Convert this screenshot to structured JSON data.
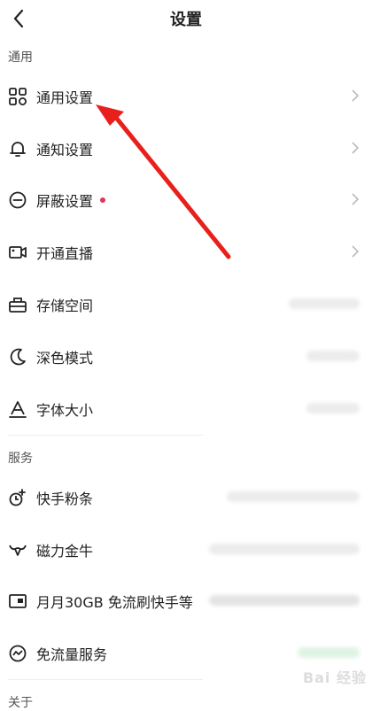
{
  "header": {
    "title": "设置"
  },
  "sections": {
    "general": "通用",
    "services": "服务",
    "about": "关于"
  },
  "rows": [
    {
      "label": "通用设置",
      "icon": "grid-icon"
    },
    {
      "label": "通知设置",
      "icon": "bell-icon"
    },
    {
      "label": "屏蔽设置",
      "icon": "block-icon",
      "badge": "red-dot"
    },
    {
      "label": "开通直播",
      "icon": "live-camera-icon"
    },
    {
      "label": "存储空间",
      "icon": "storage-box-icon"
    },
    {
      "label": "深色模式",
      "icon": "moon-icon"
    },
    {
      "label": "字体大小",
      "icon": "font-size-icon"
    },
    {
      "label": "快手粉条",
      "icon": "fans-boost-icon"
    },
    {
      "label": "磁力金牛",
      "icon": "bull-icon"
    },
    {
      "label": "月月30GB 免流刷快手等",
      "icon": "sim-card-icon"
    },
    {
      "label": "免流量服务",
      "icon": "traffic-free-icon"
    }
  ],
  "colors": {
    "accent_red": "#e0355a",
    "arrow_red": "#e8201c"
  },
  "watermark": "Bai 经验"
}
